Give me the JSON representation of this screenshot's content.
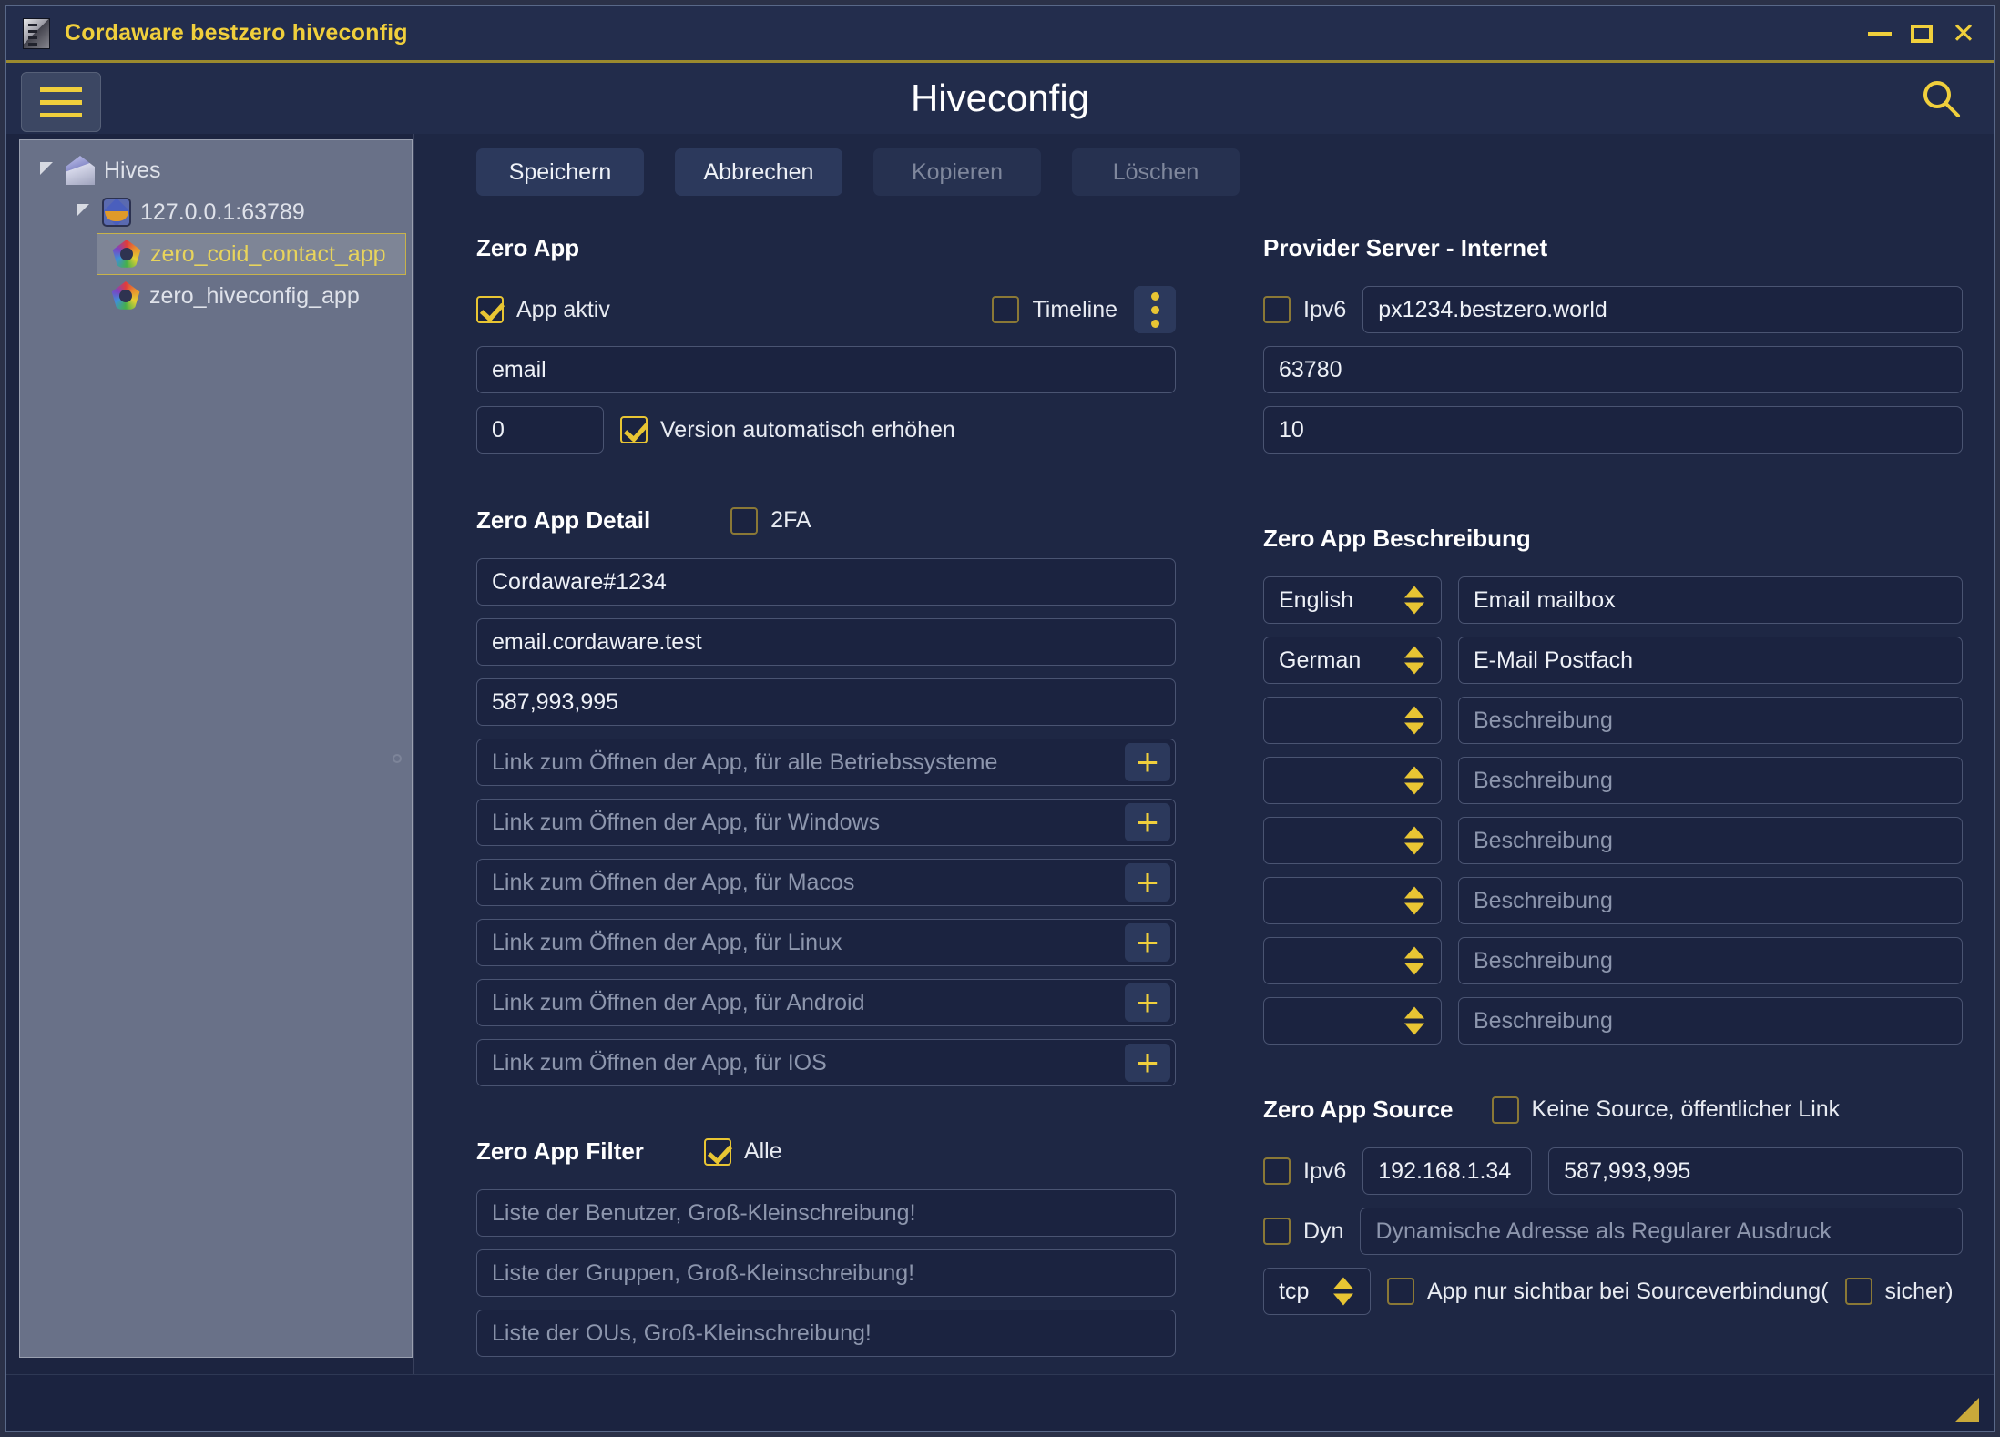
{
  "window": {
    "title": "Cordaware bestzero hiveconfig",
    "minimize_label": "Minimize",
    "maximize_label": "Maximize",
    "close_label": "Close"
  },
  "header": {
    "title": "Hiveconfig",
    "menu_label": "Menu",
    "search_label": "Search"
  },
  "toolbar": {
    "save_label": "Speichern",
    "cancel_label": "Abbrechen",
    "copy_label": "Kopieren",
    "delete_label": "Löschen"
  },
  "sidebar": {
    "tree": [
      {
        "label": "Hives",
        "level": 0,
        "icon": "house-icon",
        "expanded": true,
        "selected": false
      },
      {
        "label": "127.0.0.1:63789",
        "level": 1,
        "icon": "hive-icon",
        "expanded": true,
        "selected": false
      },
      {
        "label": "zero_coid_contact_app",
        "level": 2,
        "icon": "app-icon",
        "expanded": false,
        "selected": true
      },
      {
        "label": "zero_hiveconfig_app",
        "level": 2,
        "icon": "app-icon",
        "expanded": false,
        "selected": false
      }
    ]
  },
  "zero_app": {
    "title": "Zero App",
    "app_active_label": "App aktiv",
    "app_active_checked": true,
    "timeline_label": "Timeline",
    "timeline_checked": false,
    "name_value": "email",
    "name_placeholder": "",
    "version_value": "0",
    "auto_version_label": "Version automatisch erhöhen",
    "auto_version_checked": true
  },
  "provider_server": {
    "title": "Provider Server - Internet",
    "ipv6_label": "Ipv6",
    "ipv6_checked": false,
    "host_value": "px1234.bestzero.world",
    "port_value": "63780",
    "count_value": "10"
  },
  "zero_app_detail": {
    "title": "Zero App Detail",
    "twofa_label": "2FA",
    "twofa_checked": false,
    "fields": [
      {
        "value": "Cordaware#1234",
        "placeholder": ""
      },
      {
        "value": "email.cordaware.test",
        "placeholder": ""
      },
      {
        "value": "587,993,995",
        "placeholder": ""
      }
    ],
    "links": [
      {
        "value": "",
        "placeholder": "Link zum Öffnen der App, für alle Betriebssysteme",
        "add_label": "+"
      },
      {
        "value": "",
        "placeholder": "Link zum Öffnen der App, für Windows",
        "add_label": "+"
      },
      {
        "value": "",
        "placeholder": "Link zum Öffnen der App, für Macos",
        "add_label": "+"
      },
      {
        "value": "",
        "placeholder": "Link zum Öffnen der App, für Linux",
        "add_label": "+"
      },
      {
        "value": "",
        "placeholder": "Link zum Öffnen der App, für Android",
        "add_label": "+"
      },
      {
        "value": "",
        "placeholder": "Link zum Öffnen der App, für IOS",
        "add_label": "+"
      }
    ]
  },
  "zero_app_beschreibung": {
    "title": "Zero App Beschreibung",
    "rows": [
      {
        "language": "English",
        "text": "Email mailbox",
        "placeholder": "Beschreibung"
      },
      {
        "language": "German",
        "text": "E-Mail Postfach",
        "placeholder": "Beschreibung"
      },
      {
        "language": "",
        "text": "",
        "placeholder": "Beschreibung"
      },
      {
        "language": "",
        "text": "",
        "placeholder": "Beschreibung"
      },
      {
        "language": "",
        "text": "",
        "placeholder": "Beschreibung"
      },
      {
        "language": "",
        "text": "",
        "placeholder": "Beschreibung"
      },
      {
        "language": "",
        "text": "",
        "placeholder": "Beschreibung"
      },
      {
        "language": "",
        "text": "",
        "placeholder": "Beschreibung"
      }
    ]
  },
  "zero_app_filter": {
    "title": "Zero App Filter",
    "all_label": "Alle",
    "all_checked": true,
    "fields": [
      {
        "value": "",
        "placeholder": "Liste der Benutzer, Groß-Kleinschreibung!"
      },
      {
        "value": "",
        "placeholder": "Liste der Gruppen, Groß-Kleinschreibung!"
      },
      {
        "value": "",
        "placeholder": "Liste der OUs, Groß-Kleinschreibung!"
      }
    ]
  },
  "zero_app_source": {
    "title": "Zero App Source",
    "no_source_label": "Keine Source, öffentlicher Link",
    "no_source_checked": false,
    "ipv6_label": "Ipv6",
    "ipv6_checked": false,
    "address_value": "192.168.1.34",
    "mask_value": "587,993,995",
    "dyn_label": "Dyn",
    "dyn_checked": false,
    "dyn_placeholder": "Dynamische Adresse als Regularer Ausdruck",
    "protocol_value": "tcp",
    "visible_label": "App nur sichtbar bei Sourceverbindung(",
    "visible_checked": false,
    "secure_label": "sicher)",
    "secure_checked": false
  },
  "colors": {
    "accent": "#f0cf3c",
    "window_bg": "#1e2744",
    "titlebar_bg": "#232d4d",
    "field_bg": "#1b2340",
    "sidebar_tree_bg": "#697188"
  }
}
